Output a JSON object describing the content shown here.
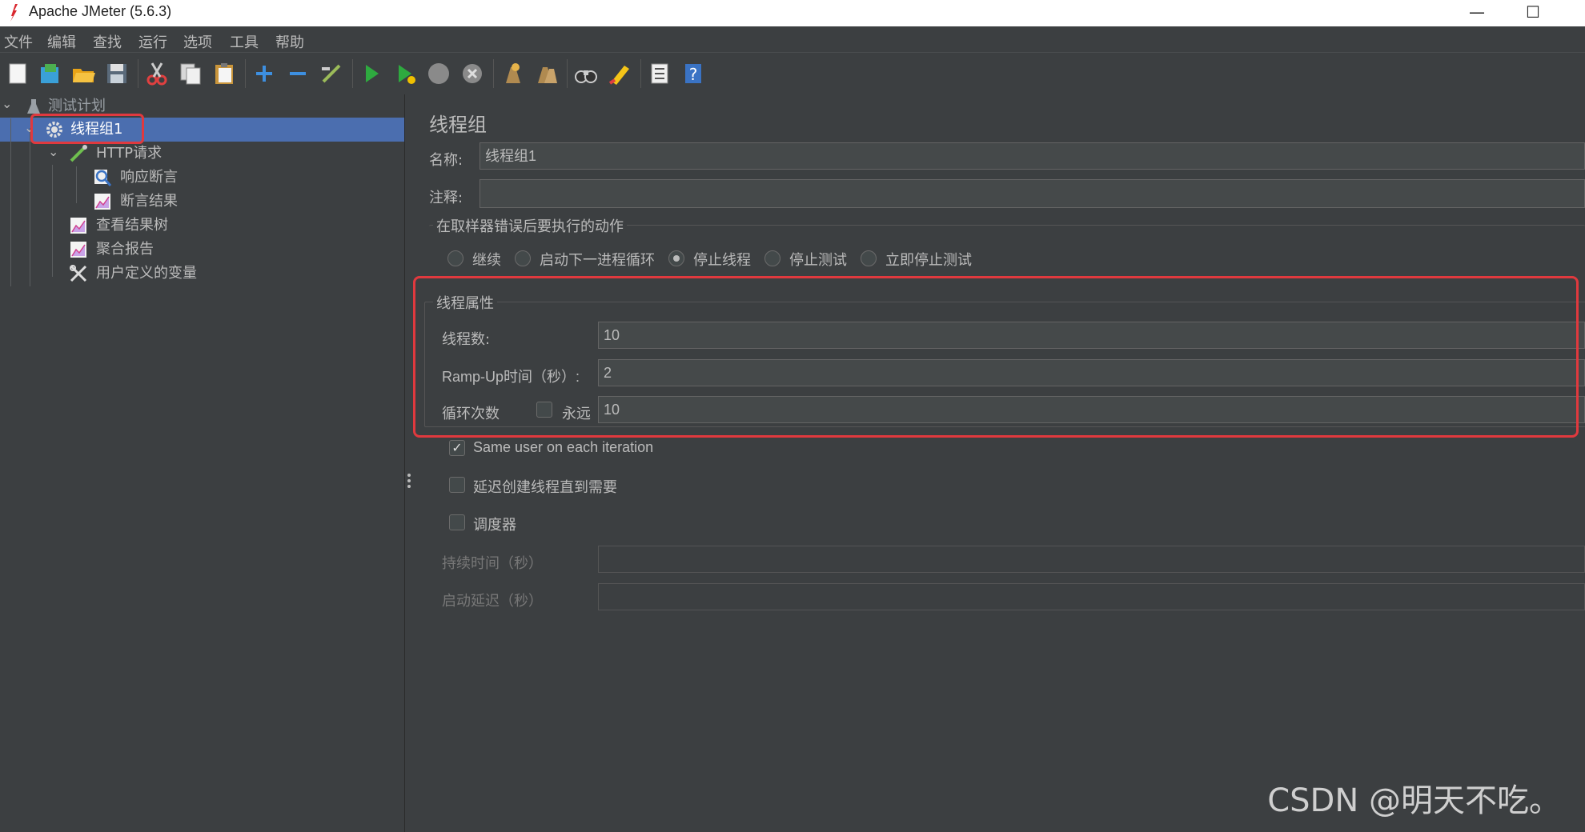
{
  "window": {
    "title": "Apache JMeter (5.6.3)",
    "minimize": "—",
    "maximize": "☐"
  },
  "menu": [
    "文件",
    "编辑",
    "查找",
    "运行",
    "选项",
    "工具",
    "帮助"
  ],
  "toolbar": {
    "icons": [
      "new-icon",
      "templates-icon",
      "open-icon",
      "save-icon",
      "cut-icon",
      "copy-icon",
      "paste-icon",
      "expand-icon",
      "collapse-icon",
      "toggle-icon",
      "start-icon",
      "start-no-pause-icon",
      "stop-icon",
      "shutdown-icon",
      "clear-icon",
      "clear-all-icon",
      "search-icon",
      "reset-search-icon",
      "function-helper-icon",
      "help-icon"
    ]
  },
  "tree": {
    "items": [
      {
        "label": "测试计划",
        "icon": "test-plan-icon"
      },
      {
        "label": "线程组1",
        "icon": "thread-group-icon"
      },
      {
        "label": "HTTP请求",
        "icon": "http-sampler-icon"
      },
      {
        "label": "响应断言",
        "icon": "assertion-icon"
      },
      {
        "label": "断言结果",
        "icon": "graph-icon"
      },
      {
        "label": "查看结果树",
        "icon": "graph-icon"
      },
      {
        "label": "聚合报告",
        "icon": "graph-icon"
      },
      {
        "label": "用户定义的变量",
        "icon": "wrench-icon"
      }
    ]
  },
  "panel": {
    "title": "线程组",
    "name_label": "名称:",
    "name_value": "线程组1",
    "comment_label": "注释:",
    "comment_value": "",
    "error_action": {
      "legend": "在取样器错误后要执行的动作",
      "options": [
        "继续",
        "启动下一进程循环",
        "停止线程",
        "停止测试",
        "立即停止测试"
      ],
      "selected": "停止线程"
    },
    "thread_props": {
      "legend": "线程属性",
      "threads_label": "线程数:",
      "threads_value": "10",
      "rampup_label": "Ramp-Up时间（秒）:",
      "rampup_value": "2",
      "loop_label": "循环次数",
      "forever_label": "永远",
      "forever_checked": false,
      "loop_value": "10"
    },
    "same_user_label": "Same user on each iteration",
    "same_user_checked": true,
    "delay_label": "延迟创建线程直到需要",
    "delay_checked": false,
    "scheduler_label": "调度器",
    "scheduler_checked": false,
    "duration_label": "持续时间（秒）",
    "duration_value": "",
    "startup_delay_label": "启动延迟（秒）",
    "startup_delay_value": ""
  },
  "watermark": "CSDN @明天不吃。",
  "colors": {
    "background": "#3c3f41",
    "selection": "#4b6eaf",
    "highlight": "#e0393e",
    "text": "#bbbbbb"
  }
}
